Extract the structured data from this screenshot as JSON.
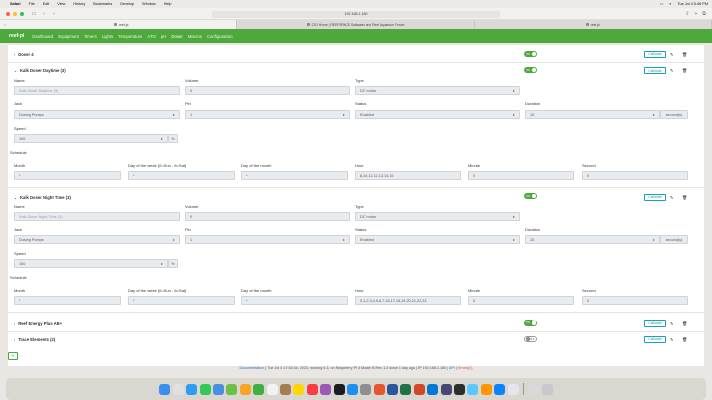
{
  "menubar": {
    "app": "Safari",
    "items": [
      "File",
      "Edit",
      "View",
      "History",
      "Bookmarks",
      "Develop",
      "Window",
      "Help"
    ],
    "clock": "Tue Jul 4  5:46 PM"
  },
  "toolbar": {
    "url": "192.168.1.180"
  },
  "tabs": [
    {
      "label": "reef-pi"
    },
    {
      "label": "CS1 Home | REEFSPACE Saltwater and Reef Aquarium Forum"
    },
    {
      "label": "reef-pi"
    }
  ],
  "nav": {
    "brand": "reef-pi",
    "items": [
      "Dashboard",
      "Equipment",
      "Timers",
      "Lights",
      "Temperature",
      "ATO",
      "pH",
      "Doser",
      "Macros",
      "Configuration"
    ]
  },
  "doser_header": {
    "title": "Doser 4",
    "toggle": "ON",
    "calibrate": "Calibrate"
  },
  "daytime": {
    "title": "Kalk Doser Daytime (3)",
    "toggle": "ON",
    "calibrate": "Calibrate",
    "labels": {
      "name": "Name",
      "volume": "Volume",
      "type": "Type",
      "jack": "Jack",
      "pin": "Pin",
      "status": "Status",
      "duration": "Duration",
      "speed": "Speed",
      "schedule": "Schedule",
      "month": "Month",
      "dow": "Day of the week (0=Sun - 6=Sat)",
      "dom": "Day of the month",
      "hour": "Hour",
      "minute": "Minute",
      "second": "Second"
    },
    "values": {
      "name": "Kalk Doser Daytime (3)",
      "volume": "0",
      "type": "DC motor",
      "jack": "Dosing Pumps",
      "pin": "1",
      "status": "Enabled",
      "duration": "10",
      "duration_unit": "second(s)",
      "speed": "100",
      "speed_unit": "%",
      "month": "*",
      "dow": "*",
      "dom": "*",
      "hour": "8,10,11,12,13,14,15",
      "minute": "0",
      "second": "0"
    }
  },
  "nighttime": {
    "title": "Kalk Doser Night Time (3)",
    "toggle": "ON",
    "calibrate": "Calibrate",
    "labels": {
      "name": "Name",
      "volume": "Volume",
      "type": "Type",
      "jack": "Jack",
      "pin": "Pin",
      "status": "Status",
      "duration": "Duration",
      "speed": "Speed",
      "schedule": "Schedule",
      "month": "Month",
      "dow": "Day of the week (0=Sun - 6=Sat)",
      "dom": "Day of the month",
      "hour": "Hour",
      "minute": "Minute",
      "second": "Second"
    },
    "values": {
      "name": "Kalk Doser Night Time (3)",
      "volume": "0",
      "type": "DC motor",
      "jack": "Dosing Pumps",
      "pin": "1",
      "status": "Enabled",
      "duration": "15",
      "duration_unit": "second(s)",
      "speed": "100",
      "speed_unit": "%",
      "month": "*",
      "dow": "*",
      "dom": "*",
      "hour": "0,1,2,3,4,5,6,7,16,17,18,19,20,21,22,23",
      "minute": "0",
      "second": "0"
    }
  },
  "reef_energy": {
    "title": "Reef Energy Plus AB+",
    "toggle": "ON",
    "calibrate": "Calibrate"
  },
  "trace": {
    "title": "Trace Elements (2)",
    "toggle": "OFF",
    "calibrate": "Calibrate"
  },
  "add_button": "+",
  "footer": {
    "documentation": "Documentation",
    "text": "| Tue Jul 4 17:53:44, 2023, running 6.3, on Raspberry Pi 4 Model B Rev 1.2 since 1 day ago | IP 192.168.1.180 |",
    "api": "API",
    "errors": "Errors(2)"
  },
  "colors": {
    "nav_green": "#4ea93d",
    "calibrate": "#17a2b8",
    "link": "#1e73c8",
    "error": "#d9534f"
  }
}
